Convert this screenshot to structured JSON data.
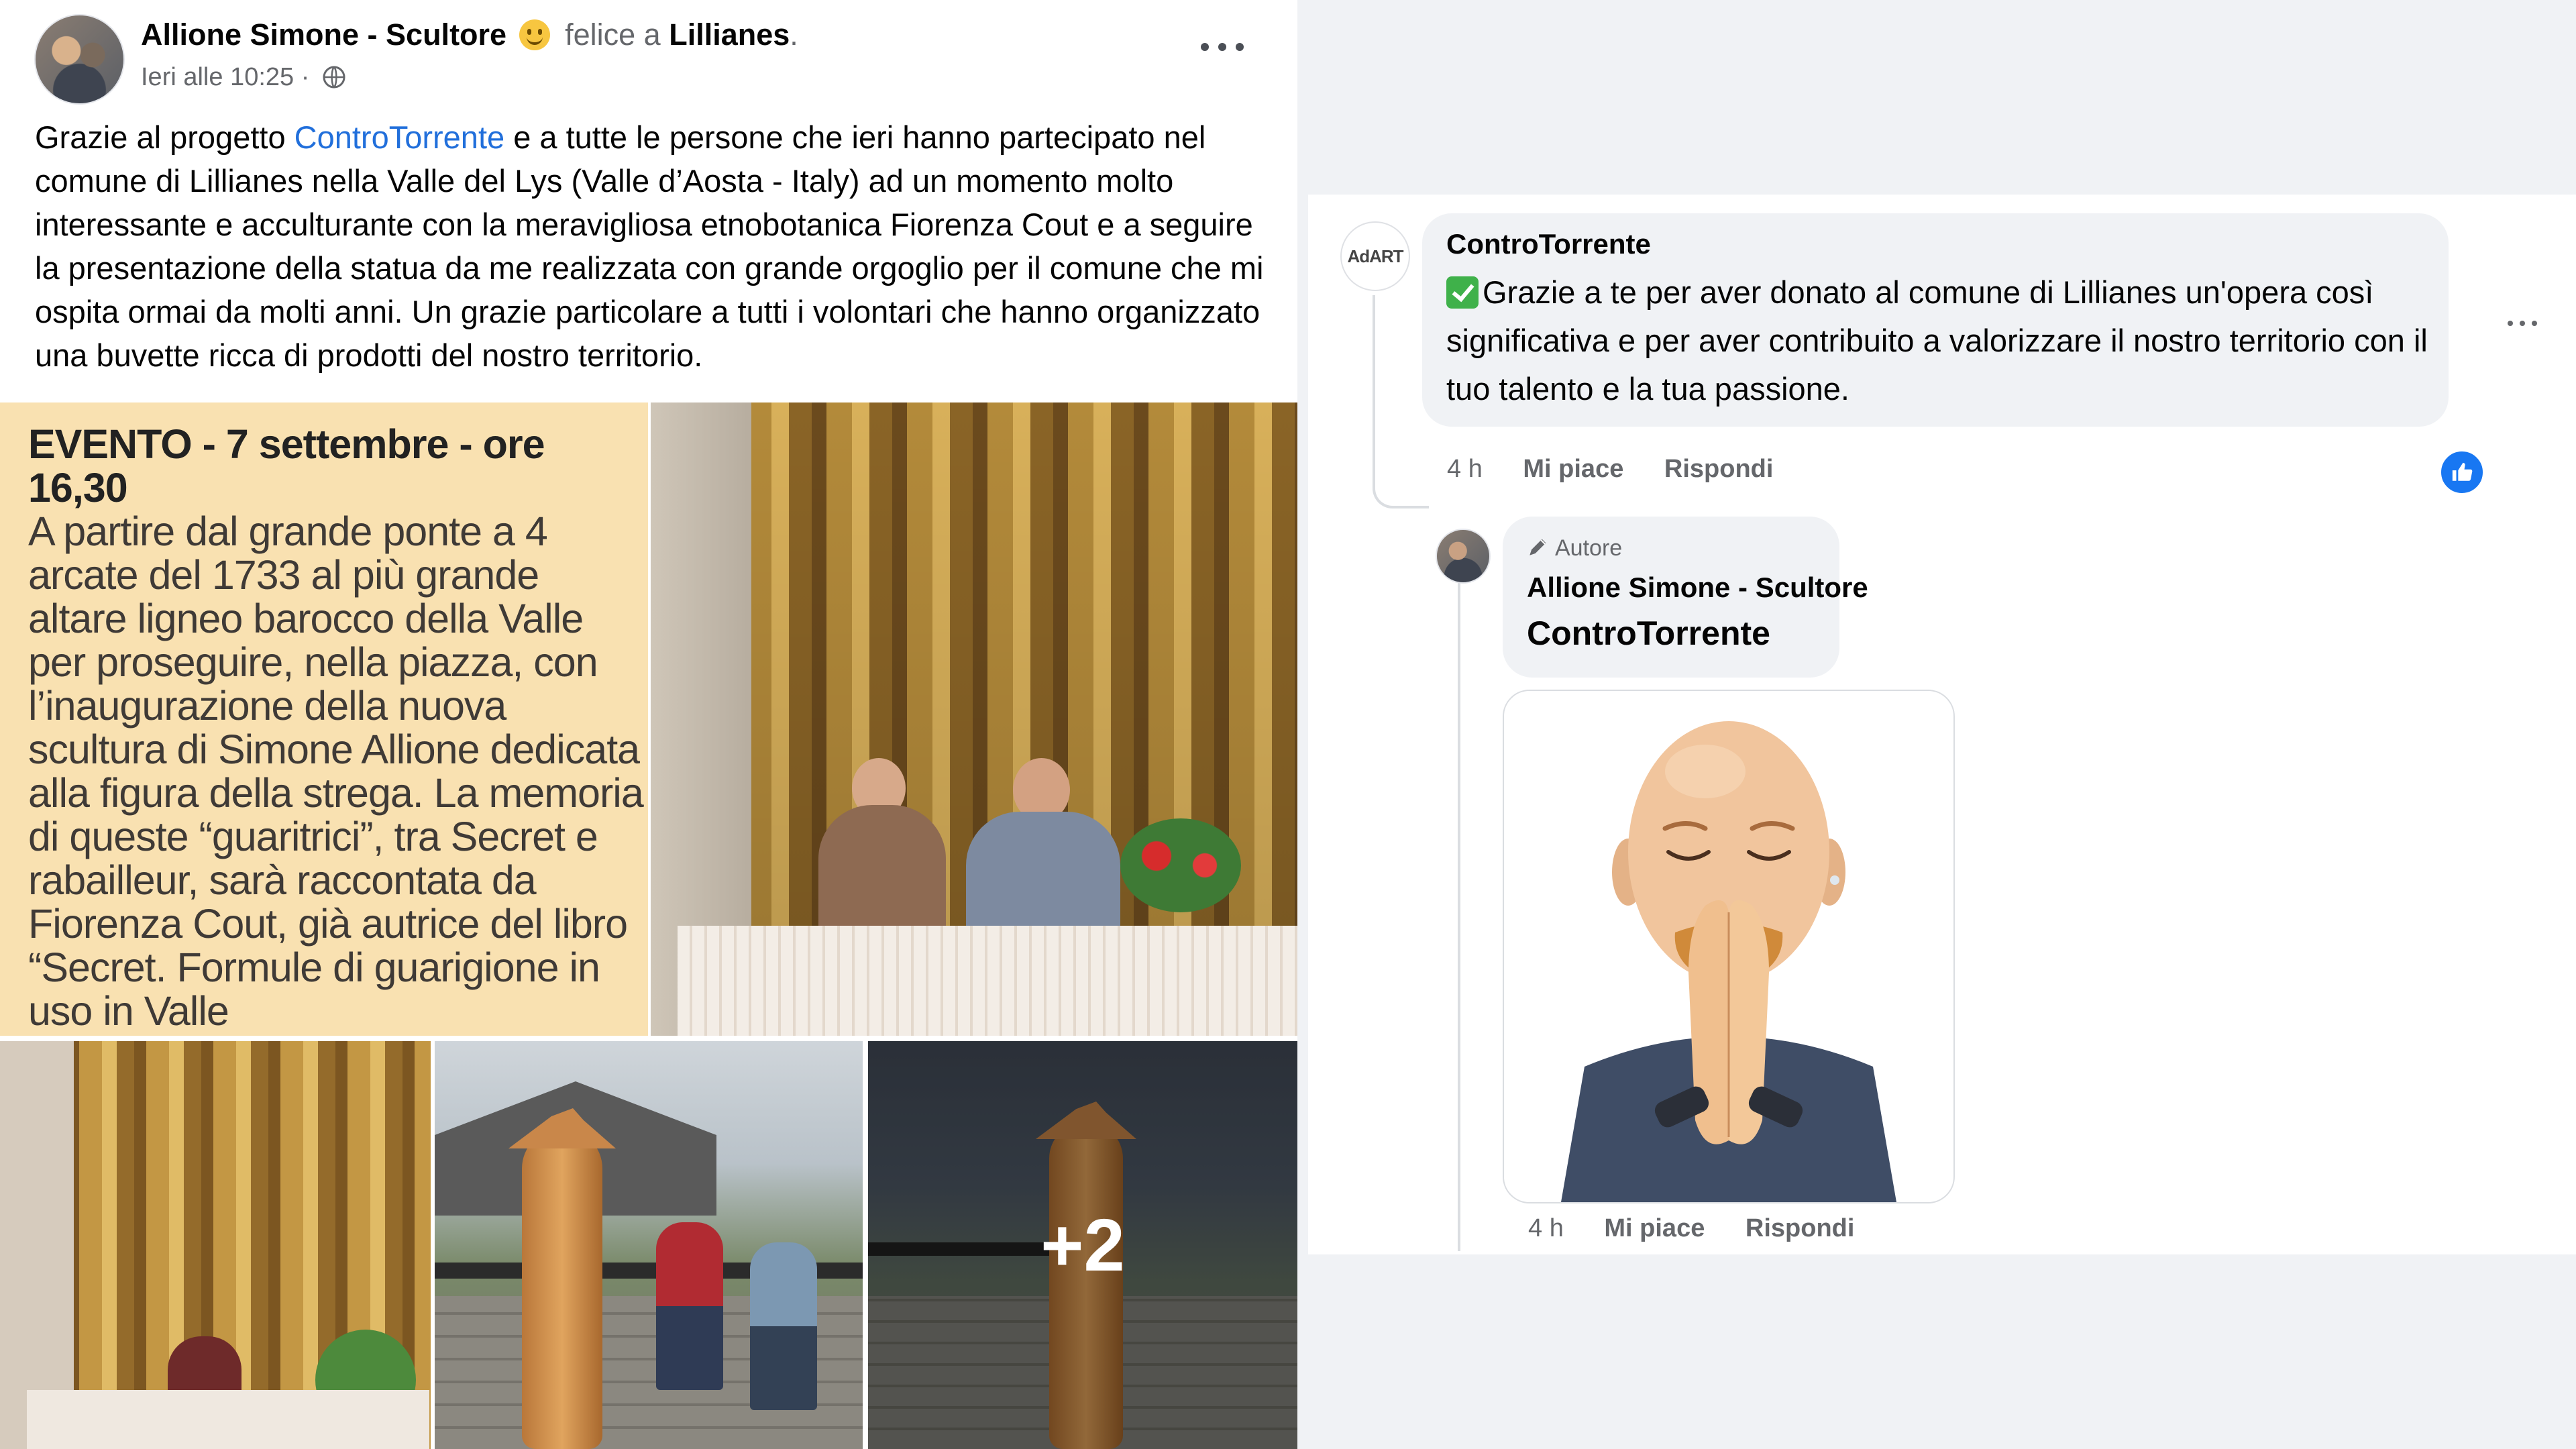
{
  "post": {
    "author": "Allione Simone - Scultore",
    "feeling": "felice a",
    "place": "Lillianes",
    "place_punct": ".",
    "timestamp": "Ieri alle 10:25 ·",
    "text_part1": "Grazie al progetto ",
    "text_link": "ControTorrente",
    "text_part2": " e a tutte le persone che ieri hanno partecipato nel comune di Lillianes nella Valle del Lys (Valle d’Aosta - Italy) ad un momento molto interessante e acculturante con la meravigliosa etnobotanica Fiorenza Cout e a seguire la presentazione della statua da me realizzata con grande orgoglio per il comune che mi ospita ormai da molti anni. Un grazie particolare a tutti i volontari che hanno organizzato una buvette ricca di prodotti del nostro territorio.",
    "more_photos": "+2",
    "newspaper": {
      "heading": "EVENTO - 7 settembre - ore 16,30",
      "body": "A partire dal grande ponte a 4 arcate del 1733 al più grande altare ligneo barocco della Valle per proseguire, nella piazza, con l’inaugurazione della nuova scultura di Simone Allione dedicata alla figura della strega. La memoria di queste “guaritrici”, tra Secret e rabailleur, sarà raccontata da Fiorenza Cout, già autrice del libro “Secret. Formule di guarigione in uso in Valle"
    }
  },
  "comments": [
    {
      "author": "ControTorrente",
      "avatar_text": "AdART",
      "text": "Grazie a te per aver donato al comune di Lillianes un'opera così significativa e per aver contribuito a valorizzare il nostro territorio con il tuo talento e la tua passione.",
      "time": "4 h",
      "like_label": "Mi piace",
      "reply_label": "Rispondi"
    }
  ],
  "reply": {
    "badge": "Autore",
    "author": "Allione Simone - Scultore",
    "mention": "ControTorrente",
    "time": "4 h",
    "like_label": "Mi piace",
    "reply_label": "Rispondi",
    "sticker": "praying-memoji-sticker"
  },
  "colors": {
    "link": "#216fdb",
    "like_blue": "#1877f2",
    "bubble": "#f0f2f5",
    "secondary_text": "#65676b"
  }
}
